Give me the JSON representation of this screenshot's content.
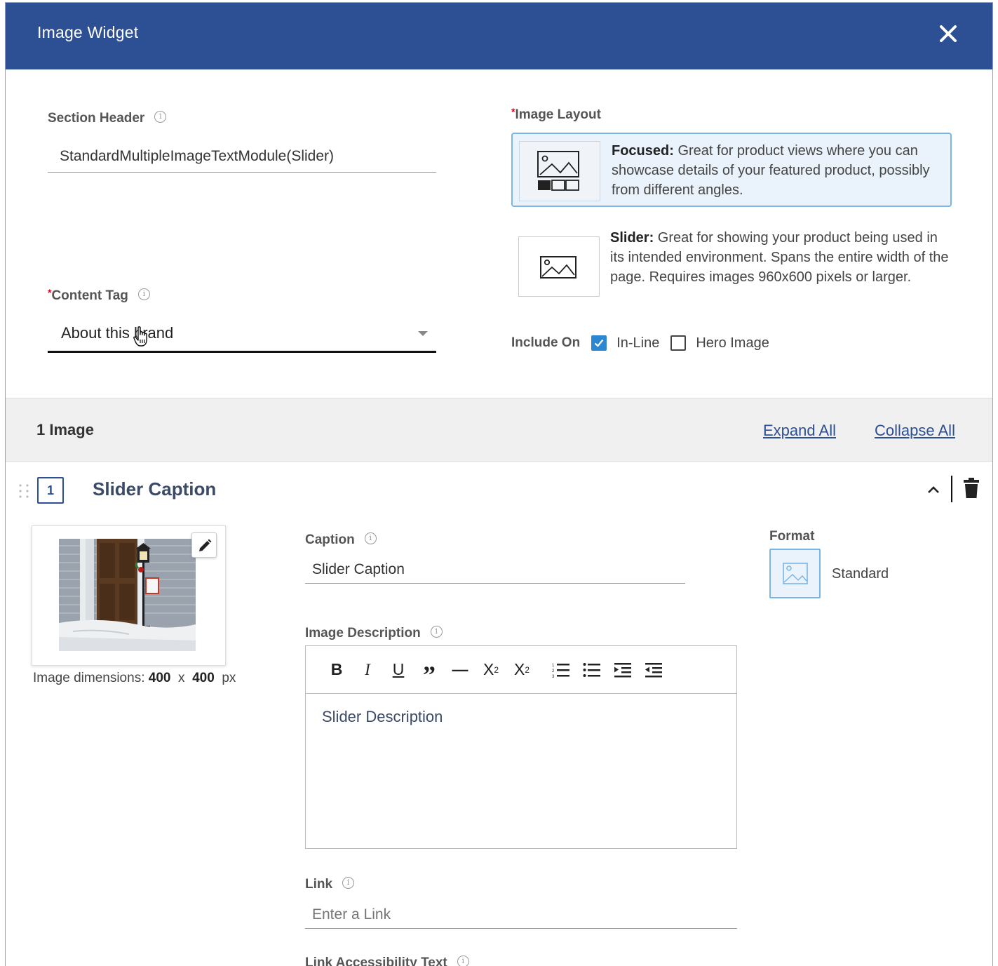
{
  "dialog": {
    "title": "Image Widget",
    "close_icon": "close-icon"
  },
  "section_header": {
    "label": "Section Header",
    "value": "StandardMultipleImageTextModule(Slider)"
  },
  "content_tag": {
    "required_mark": "*",
    "label": "Content Tag",
    "value": "About this brand"
  },
  "image_layout": {
    "required_mark": "*",
    "label": "Image Layout",
    "options": [
      {
        "name": "Focused:",
        "description": " Great for product views where you can showcase details of your featured product, possibly from different angles.",
        "selected": true
      },
      {
        "name": "Slider:",
        "description": " Great for showing your product being used in its intended environment. Spans the entire width of the page. Requires images 960x600 pixels or larger.",
        "selected": false
      }
    ]
  },
  "include_on": {
    "label": "Include On",
    "options": [
      {
        "label": "In-Line",
        "checked": true
      },
      {
        "label": "Hero Image",
        "checked": false
      }
    ]
  },
  "images_section": {
    "count_label": "1 Image",
    "expand_all": "Expand All",
    "collapse_all": "Collapse All"
  },
  "image_item": {
    "number": "1",
    "title": "Slider Caption",
    "dimensions_prefix": "Image dimensions: ",
    "width": "400",
    "times": "x",
    "height": "400",
    "unit": "px",
    "caption": {
      "label": "Caption",
      "value": "Slider Caption"
    },
    "description": {
      "label": "Image Description",
      "toolbar": {
        "bold": "B",
        "italic": "I",
        "underline": "U",
        "quote": "”",
        "hr": "—",
        "subscript": "X",
        "subscript_mark": "2",
        "superscript": "X",
        "superscript_mark": "2"
      },
      "value": "Slider Description"
    },
    "link": {
      "label": "Link",
      "placeholder": "Enter a Link"
    },
    "link_accessibility": {
      "label": "Link Accessibility Text"
    },
    "format": {
      "label": "Format",
      "value": "Standard"
    }
  },
  "colors": {
    "header_bg": "#2d4f94",
    "accent": "#2b87d1",
    "selected_bg": "#eaf3fb",
    "selected_border": "#7ab6e5",
    "required": "#d0021b"
  }
}
